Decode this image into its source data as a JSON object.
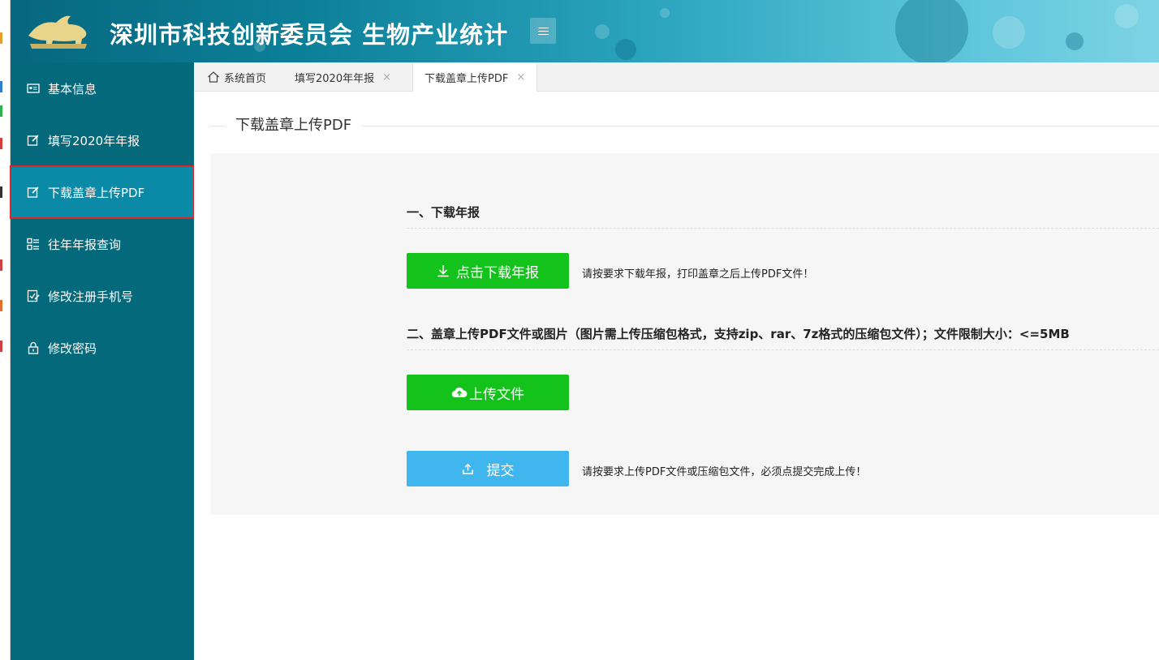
{
  "header": {
    "title": "深圳市科技创新委员会 生物产业统计",
    "logo_icon": "bull-logo-icon",
    "menu_icon": "hamburger-icon"
  },
  "sidebar": {
    "items": [
      {
        "label": "基本信息",
        "icon": "id-card-icon",
        "active": false
      },
      {
        "label": "填写2020年年报",
        "icon": "edit-icon",
        "active": false
      },
      {
        "label": "下载盖章上传PDF",
        "icon": "edit-icon",
        "active": true
      },
      {
        "label": "往年年报查询",
        "icon": "grid-list-icon",
        "active": false
      },
      {
        "label": "修改注册手机号",
        "icon": "phone-edit-icon",
        "active": false
      },
      {
        "label": "修改密码",
        "icon": "lock-icon",
        "active": false
      }
    ]
  },
  "tabs": [
    {
      "label": "系统首页",
      "icon": "home-icon",
      "closable": false
    },
    {
      "label": "填写2020年年报",
      "closable": true
    },
    {
      "label": "下载盖章上传PDF",
      "closable": true,
      "active": true
    }
  ],
  "tab_close_glyph": "×",
  "main": {
    "page_title": "下载盖章上传PDF",
    "section1": {
      "title": "一、下载年报",
      "button_label": "点击下载年报",
      "hint": "请按要求下载年报，打印盖章之后上传PDF文件！"
    },
    "section2": {
      "title": "二、盖章上传PDF文件或图片（图片需上传压缩包格式，支持zip、rar、7z格式的压缩包文件）；文件限制大小：<=5MB",
      "button_label": "上传文件"
    },
    "submit": {
      "button_label": "提交",
      "hint": "请按要求上传PDF文件或压缩包文件，必须点提交完成上传！"
    }
  },
  "colors": {
    "sidebar_bg": "#05697c",
    "sidebar_active": "#0a8aa7",
    "button_green": "#13c31b",
    "button_blue": "#40b6ee",
    "highlight_border": "#e02424"
  }
}
